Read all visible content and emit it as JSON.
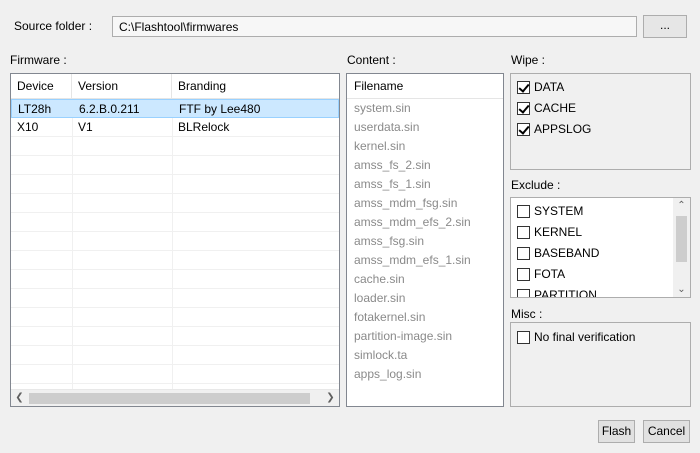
{
  "source": {
    "label": "Source folder :",
    "value": "C:\\Flashtool\\firmwares",
    "browse_label": "..."
  },
  "firmware": {
    "label": "Firmware :",
    "columns": [
      "Device",
      "Version",
      "Branding"
    ],
    "rows": [
      {
        "device": "LT28h",
        "version": "6.2.B.0.211",
        "branding": "FTF by Lee480",
        "selected": true
      },
      {
        "device": "X10",
        "version": "V1",
        "branding": "BLRelock",
        "selected": false
      }
    ]
  },
  "content": {
    "label": "Content :",
    "header": "Filename",
    "files": [
      "system.sin",
      "userdata.sin",
      "kernel.sin",
      "amss_fs_2.sin",
      "amss_fs_1.sin",
      "amss_mdm_fsg.sin",
      "amss_mdm_efs_2.sin",
      "amss_fsg.sin",
      "amss_mdm_efs_1.sin",
      "cache.sin",
      "loader.sin",
      "fotakernel.sin",
      "partition-image.sin",
      "simlock.ta",
      "apps_log.sin"
    ]
  },
  "wipe": {
    "label": "Wipe :",
    "items": [
      {
        "label": "DATA",
        "checked": true
      },
      {
        "label": "CACHE",
        "checked": true
      },
      {
        "label": "APPSLOG",
        "checked": true
      }
    ]
  },
  "exclude": {
    "label": "Exclude :",
    "items": [
      {
        "label": "SYSTEM",
        "checked": false
      },
      {
        "label": "KERNEL",
        "checked": false
      },
      {
        "label": "BASEBAND",
        "checked": false
      },
      {
        "label": "FOTA",
        "checked": false
      },
      {
        "label": "PARTITION",
        "checked": false
      }
    ]
  },
  "misc": {
    "label": "Misc :",
    "items": [
      {
        "label": "No final verification",
        "checked": false
      }
    ]
  },
  "buttons": {
    "flash": "Flash",
    "cancel": "Cancel"
  },
  "colors": {
    "selection": "#cce8ff",
    "selection_border": "#99d1ff",
    "file_text": "#8a8a8a"
  }
}
